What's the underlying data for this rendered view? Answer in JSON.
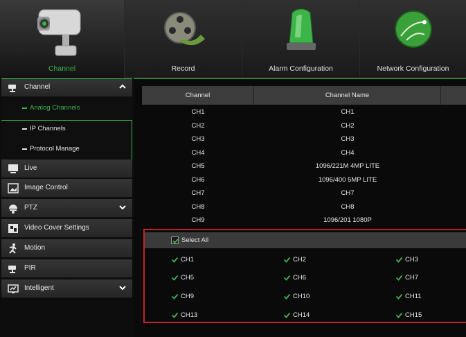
{
  "top_tabs": [
    {
      "label": "Channel",
      "icon": "camera-icon",
      "active": true
    },
    {
      "label": "Record",
      "icon": "film-reel-icon",
      "active": false
    },
    {
      "label": "Alarm Configuration",
      "icon": "alarm-light-icon",
      "active": false
    },
    {
      "label": "Network Configuration",
      "icon": "network-globe-icon",
      "active": false
    }
  ],
  "sidebar": {
    "channel": {
      "label": "Channel",
      "icon": "camera-icon"
    },
    "subitems": [
      {
        "label": "Analog Channels",
        "active": true
      },
      {
        "label": "IP Channels",
        "active": false
      },
      {
        "label": "Protocol Manage",
        "active": false
      }
    ],
    "items": [
      {
        "label": "Live",
        "icon": "monitor-icon"
      },
      {
        "label": "Image Control",
        "icon": "image-icon"
      },
      {
        "label": "PTZ",
        "icon": "ptz-camera-icon"
      },
      {
        "label": "Video Cover Settings",
        "icon": "video-cover-icon"
      },
      {
        "label": "Motion",
        "icon": "running-man-icon"
      },
      {
        "label": "PIR",
        "icon": "camera-icon"
      },
      {
        "label": "Intelligent",
        "icon": "intelligent-icon"
      }
    ]
  },
  "table": {
    "headers": [
      "Channel",
      "Channel Name"
    ],
    "rows": [
      [
        "CH1",
        "CH1"
      ],
      [
        "CH2",
        "CH2"
      ],
      [
        "CH3",
        "CH3"
      ],
      [
        "CH4",
        "CH4"
      ],
      [
        "CH5",
        "1096/221M 4MP LITE"
      ],
      [
        "CH6",
        "1096/400 5MP LITE"
      ],
      [
        "CH7",
        "CH7"
      ],
      [
        "CH8",
        "CH8"
      ],
      [
        "CH9",
        "1096/201 1080P"
      ]
    ]
  },
  "selection": {
    "select_all_label": "Select All",
    "channels": [
      "CH1",
      "CH2",
      "CH3",
      "CH5",
      "CH6",
      "CH7",
      "CH9",
      "CH10",
      "CH11",
      "CH13",
      "CH14",
      "CH15"
    ]
  },
  "colors": {
    "accent": "#3cb44a",
    "highlight_border": "#c8202a"
  }
}
